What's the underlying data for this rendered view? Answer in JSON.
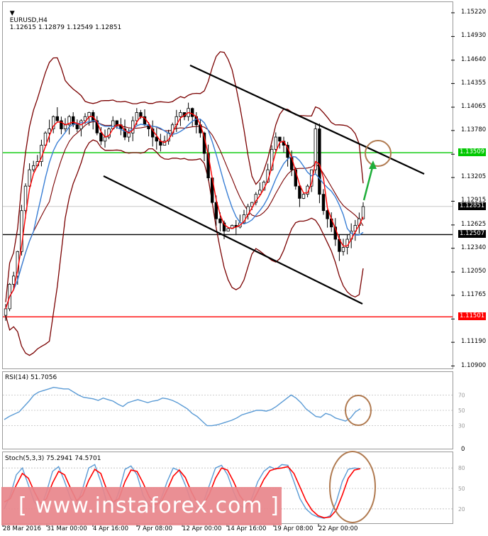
{
  "header": {
    "symbol": "EURUSD,H4",
    "ohlc": "1.12615 1.12879 1.12549 1.12851",
    "rsi_label": "RSI(14) 51.7056",
    "stoch_label": "Stoch(5,3,3) 75.2941 74.5701"
  },
  "watermark": {
    "text": "[ www.instaforex.com ]"
  },
  "colors": {
    "candles": "#000000",
    "fast_ma": "#ff0000",
    "slow_ma": "#3a7fd5",
    "bollinger": "#7a0000",
    "channel": "#000000",
    "support_line": "#000000",
    "resistance_line": "#00c800",
    "lower_line": "#ff0000",
    "rsi_line": "#5b9bd5",
    "stoch_main": "#5b9bd5",
    "stoch_signal": "#ff0000",
    "annotation_circle": "#b07a50",
    "annotation_arrow": "#1fae3a"
  },
  "chart_data": {
    "type": "candlestick",
    "title": "EURUSD,H4",
    "price_axis": [
      "1.15220",
      "1.14930",
      "1.14640",
      "1.14355",
      "1.14065",
      "1.13780",
      "1.13490",
      "1.13205",
      "1.12915",
      "1.12625",
      "1.12340",
      "1.12050",
      "1.11765",
      "1.11475",
      "1.11190",
      "1.10900"
    ],
    "x_labels": [
      "28 Mar 2016",
      "31 Mar 00:00",
      "4 Apr 16:00",
      "7 Apr 08:00",
      "12 Apr 00:00",
      "14 Apr 16:00",
      "19 Apr 08:00",
      "22 Apr 00:00"
    ],
    "ylim": [
      1.109,
      1.1535
    ],
    "horizontal_levels": [
      {
        "price": 1.13509,
        "label": "1.13509",
        "color": "#00c800"
      },
      {
        "price": 1.12507,
        "label": "1.12507",
        "color": "#000000"
      },
      {
        "price": 1.11501,
        "label": "1.11501",
        "color": "#ff0000"
      }
    ],
    "current_price": {
      "price": 1.12851,
      "label": "1.12851"
    },
    "close_path": [
      1.116,
      1.119,
      1.12,
      1.123,
      1.128,
      1.131,
      1.133,
      1.1335,
      1.134,
      1.136,
      1.1375,
      1.138,
      1.1395,
      1.139,
      1.138,
      1.1385,
      1.1395,
      1.1385,
      1.138,
      1.139,
      1.1395,
      1.14,
      1.139,
      1.1375,
      1.1365,
      1.137,
      1.138,
      1.139,
      1.1385,
      1.138,
      1.137,
      1.1375,
      1.139,
      1.14,
      1.1395,
      1.1385,
      1.138,
      1.137,
      1.1365,
      1.136,
      1.1365,
      1.1375,
      1.1385,
      1.1395,
      1.14,
      1.1395,
      1.1405,
      1.1395,
      1.1385,
      1.1375,
      1.135,
      1.132,
      1.129,
      1.127,
      1.1265,
      1.1255,
      1.1258,
      1.1262,
      1.126,
      1.1265,
      1.1275,
      1.1285,
      1.129,
      1.13,
      1.1305,
      1.1315,
      1.133,
      1.1355,
      1.137,
      1.1365,
      1.136,
      1.1345,
      1.133,
      1.131,
      1.1295,
      1.13,
      1.131,
      1.133,
      1.138,
      1.13,
      1.128,
      1.127,
      1.126,
      1.1245,
      1.123,
      1.1235,
      1.1245,
      1.1255,
      1.1262,
      1.127,
      1.1285
    ],
    "rsi": {
      "label": "RSI(14) 51.7056",
      "levels": [
        70,
        50,
        30
      ],
      "range": [
        0,
        100
      ],
      "values": [
        38,
        42,
        45,
        48,
        55,
        62,
        70,
        74,
        76,
        78,
        80,
        79,
        78,
        78,
        74,
        70,
        67,
        66,
        65,
        63,
        66,
        64,
        62,
        58,
        55,
        60,
        62,
        64,
        62,
        60,
        62,
        63,
        66,
        65,
        63,
        60,
        56,
        52,
        46,
        42,
        36,
        30,
        30,
        31,
        33,
        35,
        37,
        40,
        44,
        46,
        48,
        50,
        50,
        49,
        51,
        55,
        60,
        65,
        70,
        66,
        60,
        52,
        47,
        42,
        41,
        46,
        44,
        40,
        38,
        36,
        40,
        48,
        52
      ]
    },
    "stochastic": {
      "label": "Stoch(5,3,3) 75.2941 74.5701",
      "levels": [
        80,
        50,
        20
      ],
      "range": [
        0,
        100
      ],
      "main": [
        20,
        40,
        70,
        80,
        55,
        30,
        20,
        45,
        75,
        82,
        60,
        35,
        25,
        50,
        80,
        85,
        60,
        30,
        22,
        45,
        78,
        83,
        70,
        40,
        25,
        20,
        35,
        60,
        80,
        76,
        55,
        30,
        18,
        30,
        55,
        80,
        84,
        70,
        45,
        25,
        20,
        35,
        60,
        75,
        82,
        78,
        85,
        84,
        60,
        35,
        20,
        12,
        8,
        6,
        10,
        30,
        60,
        78,
        80,
        79
      ],
      "signal": [
        30,
        35,
        55,
        72,
        65,
        45,
        28,
        35,
        58,
        75,
        70,
        50,
        32,
        40,
        62,
        78,
        72,
        48,
        30,
        35,
        60,
        77,
        75,
        58,
        38,
        26,
        30,
        48,
        68,
        77,
        66,
        45,
        28,
        26,
        42,
        65,
        80,
        77,
        60,
        40,
        28,
        28,
        45,
        63,
        76,
        79,
        80,
        82,
        72,
        52,
        32,
        18,
        10,
        7,
        8,
        18,
        40,
        65,
        77,
        79
      ]
    }
  }
}
